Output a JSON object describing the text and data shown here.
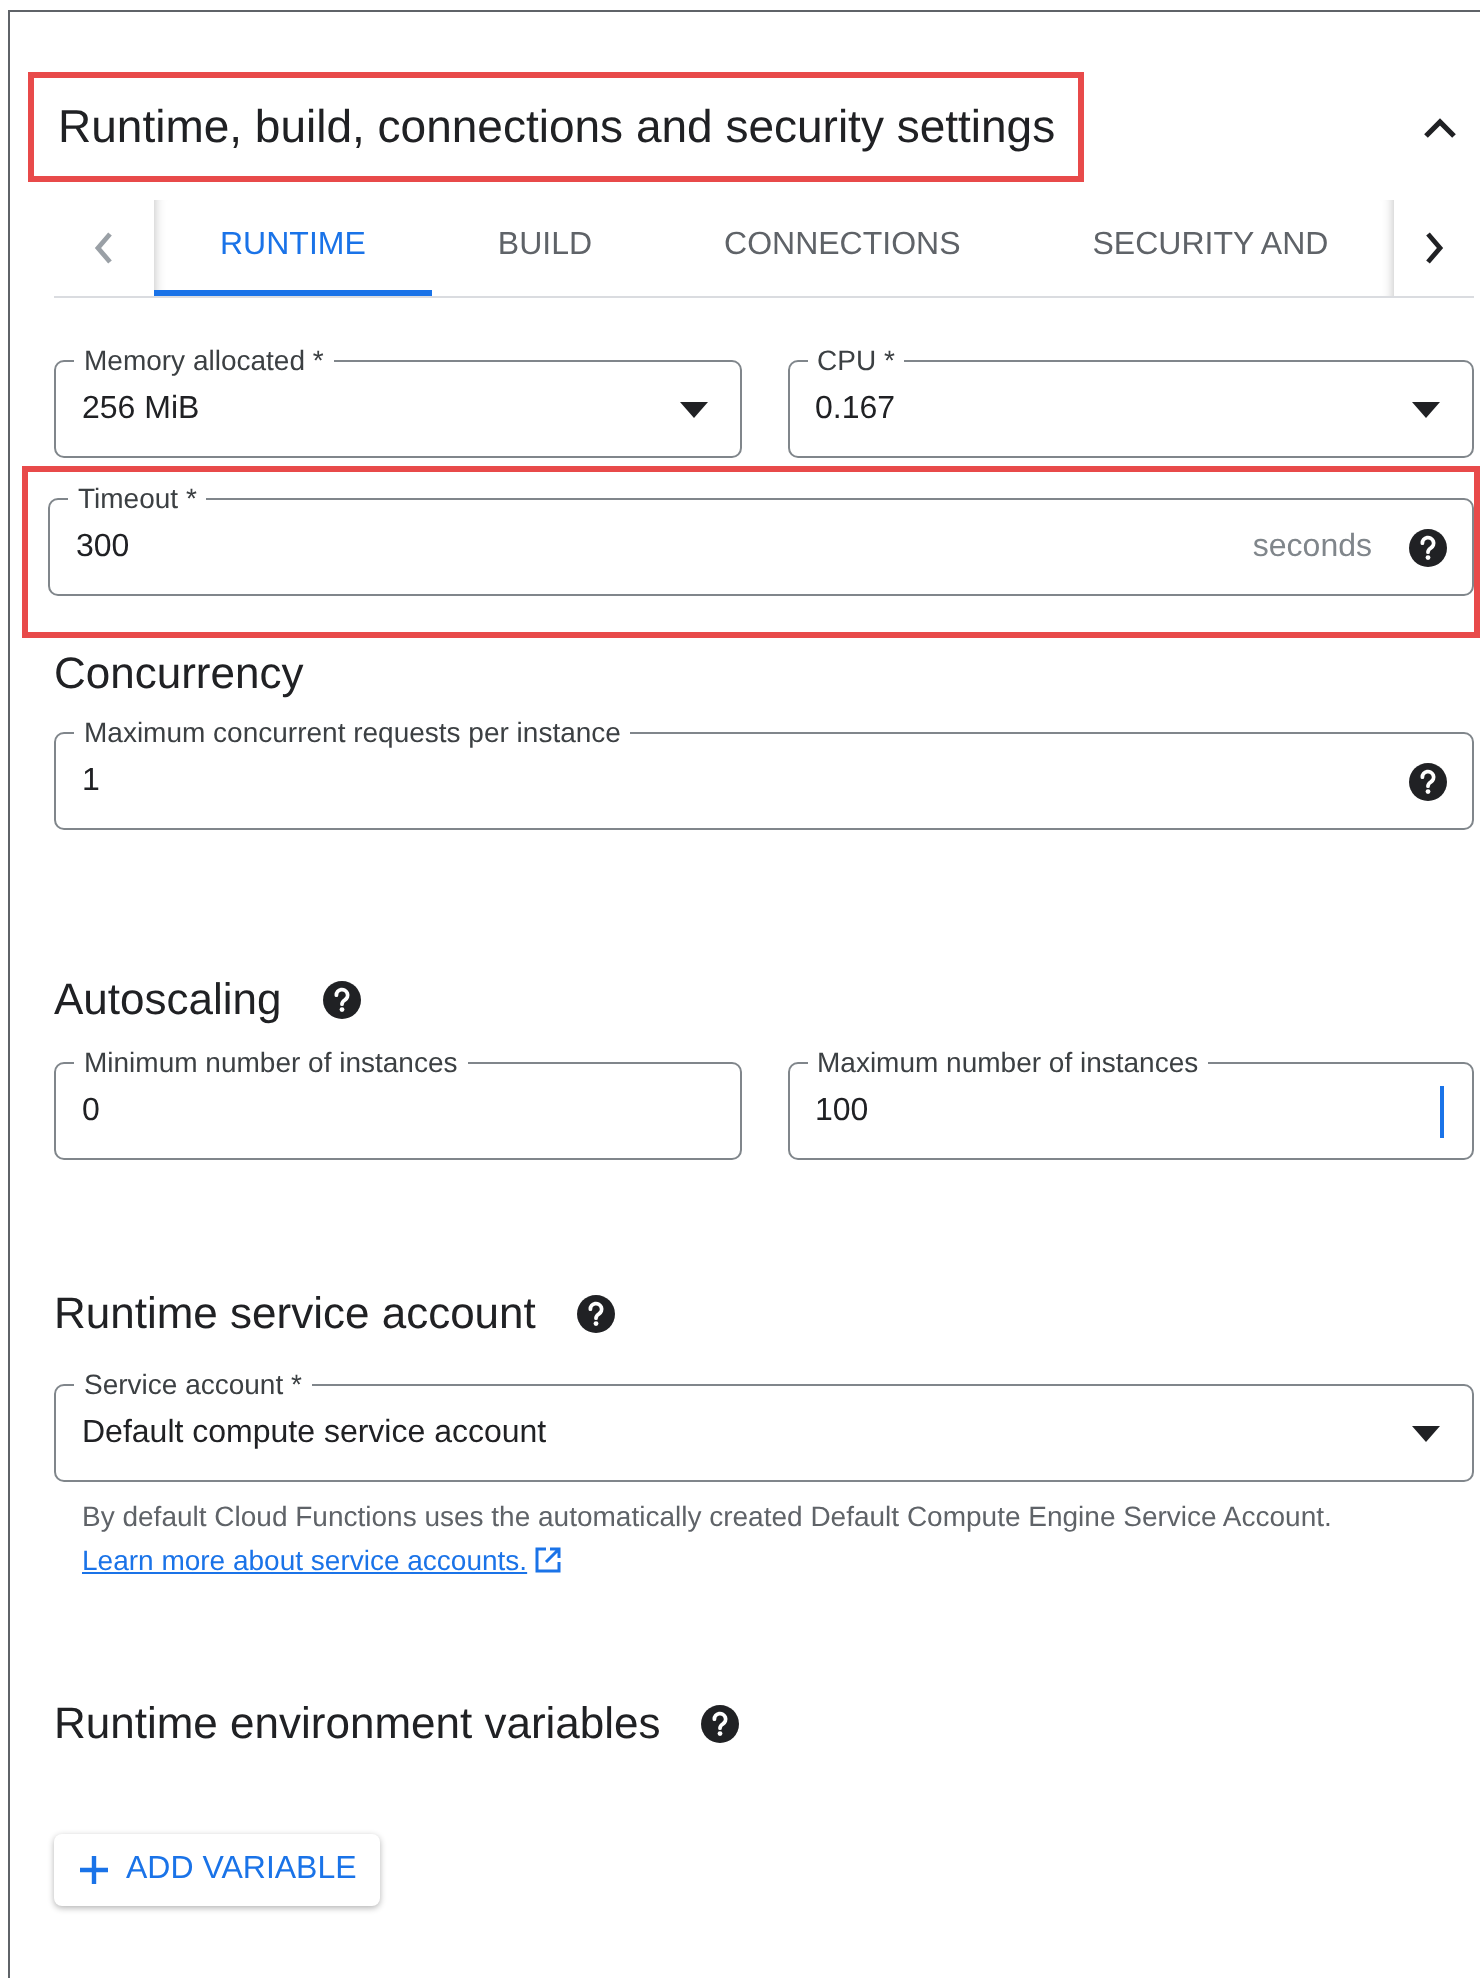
{
  "section": {
    "title": "Runtime, build, connections and security settings",
    "highlighted": true,
    "expanded": true
  },
  "tabs": [
    {
      "label": "RUNTIME",
      "selected": true
    },
    {
      "label": "BUILD",
      "selected": false
    },
    {
      "label": "CONNECTIONS",
      "selected": false
    },
    {
      "label": "SECURITY AND",
      "selected": false
    }
  ],
  "tab_scroll": {
    "left_disabled": true,
    "right_disabled": false
  },
  "memory_field": {
    "kind": "select",
    "label": "Memory allocated *",
    "value": "256 MiB"
  },
  "cpu_field": {
    "kind": "select",
    "label": "CPU *",
    "value": "0.167"
  },
  "timeout_field": {
    "kind": "text",
    "label": "Timeout *",
    "value": "300",
    "suffix": "seconds",
    "help": true,
    "highlighted": true
  },
  "concurrency": {
    "heading": "Concurrency",
    "field": {
      "kind": "text",
      "label": "Maximum concurrent requests per instance",
      "value": "1",
      "help": true
    }
  },
  "autoscaling": {
    "heading": "Autoscaling",
    "help": true,
    "min_field": {
      "kind": "text",
      "label": "Minimum number of instances",
      "value": "0"
    },
    "max_field": {
      "kind": "text",
      "label": "Maximum number of instances",
      "value": "100",
      "focused": true
    }
  },
  "service_account": {
    "heading": "Runtime service account",
    "help": true,
    "field": {
      "kind": "select",
      "label": "Service account *",
      "value": "Default compute service account"
    },
    "hint": "By default Cloud Functions uses the automatically created Default Compute Engine Service Account.",
    "link": "Learn more about service accounts."
  },
  "env_vars": {
    "heading": "Runtime environment variables",
    "help": true,
    "button": "ADD VARIABLE"
  }
}
